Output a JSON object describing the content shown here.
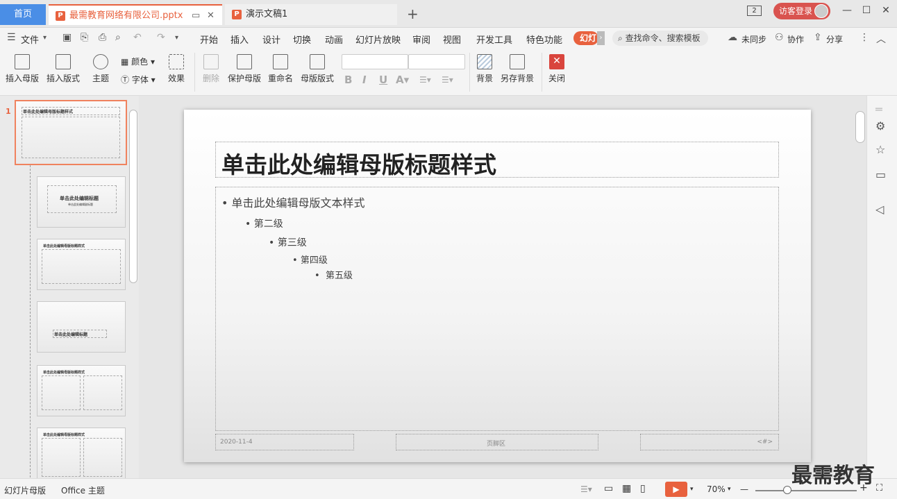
{
  "tabs": {
    "home": "首页",
    "doc1": "最需教育网络有限公司.pptx",
    "doc2": "演示文稿1",
    "plus": "+"
  },
  "window": {
    "badge": "2",
    "login": "访客登录",
    "minimize": "—",
    "maximize": "☐",
    "close": "✕"
  },
  "menu": {
    "file": "文件",
    "items": [
      "开始",
      "插入",
      "设计",
      "切换",
      "动画",
      "幻灯片放映",
      "审阅",
      "视图",
      "开发工具",
      "特色功能"
    ],
    "pill": "幻灯",
    "search": "查找命令、搜索模板",
    "sync": "未同步",
    "collab": "协作",
    "share": "分享"
  },
  "ribbon": {
    "insert_master": "插入母版",
    "insert_layout": "插入版式",
    "theme": "主题",
    "color": "颜色",
    "font": "字体",
    "effect": "效果",
    "delete": "删除",
    "protect_master": "保护母版",
    "rename": "重命名",
    "master_layout": "母版版式",
    "background": "背景",
    "save_background": "另存背景",
    "close": "关闭"
  },
  "thumbs": {
    "master_title": "单击此处编辑母版标题样式",
    "title2": "单击此处编辑标题",
    "sub2": "单击此处编辑副标题",
    "title4": "单击此处编辑标题",
    "slide_number": "1"
  },
  "slide": {
    "title": "单击此处编辑母版标题样式",
    "level1": "单击此处编辑母版文本样式",
    "level2": "第二级",
    "level3": "第三级",
    "level4": "第四级",
    "level5": "第五级",
    "date": "2020-11-4",
    "footer": "页脚区",
    "number": "<#>"
  },
  "status": {
    "view": "幻灯片母版",
    "theme": "Office 主题",
    "zoom": "70%",
    "minus": "—",
    "plus": "+"
  },
  "watermark": "最需教育",
  "colors": {
    "accent": "#e8613e",
    "home_tab": "#4a8ee6",
    "login": "#d9534f"
  }
}
